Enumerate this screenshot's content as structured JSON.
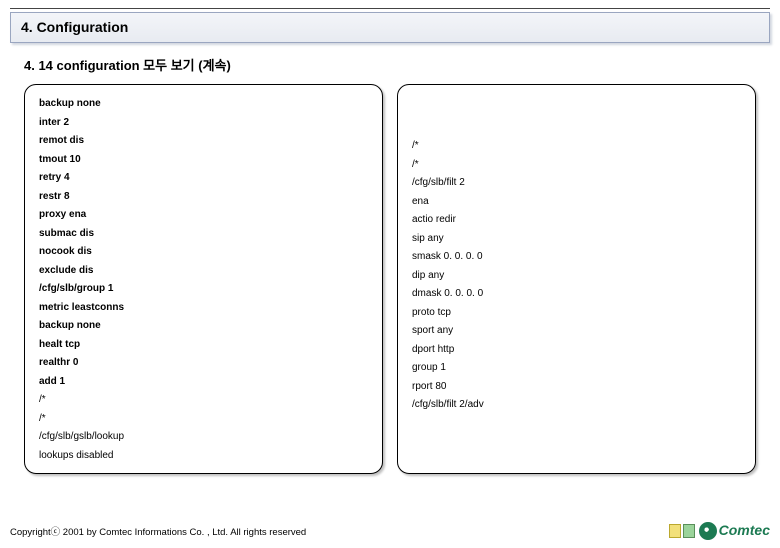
{
  "section": {
    "title": "4. Configuration",
    "subtitle": "4. 14 configuration 모두 보기 (계속)"
  },
  "left_lines": [
    "backup none",
    "inter 2",
    "remot dis",
    "tmout 10",
    "retry 4",
    "restr 8",
    "proxy ena",
    "submac dis",
    "nocook dis",
    "exclude dis",
    "/cfg/slb/group 1",
    "metric leastconns",
    "backup none",
    "healt tcp",
    "realthr 0",
    "add 1",
    "/*",
    "/*"
  ],
  "left_thin": [
    "/cfg/slb/gslb/lookup",
    "lookups disabled"
  ],
  "right_lines": [
    "/*",
    "/*",
    "/cfg/slb/filt 2",
    "ena",
    "actio redir",
    "sip any",
    "smask 0. 0. 0. 0",
    "dip any",
    "dmask 0. 0. 0. 0",
    "proto tcp",
    "sport any",
    "dport http",
    "group 1",
    "rport 80",
    "/cfg/slb/filt 2/adv"
  ],
  "footer": {
    "copyright": "Copyrightⓒ 2001 by Comtec Informations Co. , Ltd. All rights reserved",
    "brand": "Comtec"
  }
}
